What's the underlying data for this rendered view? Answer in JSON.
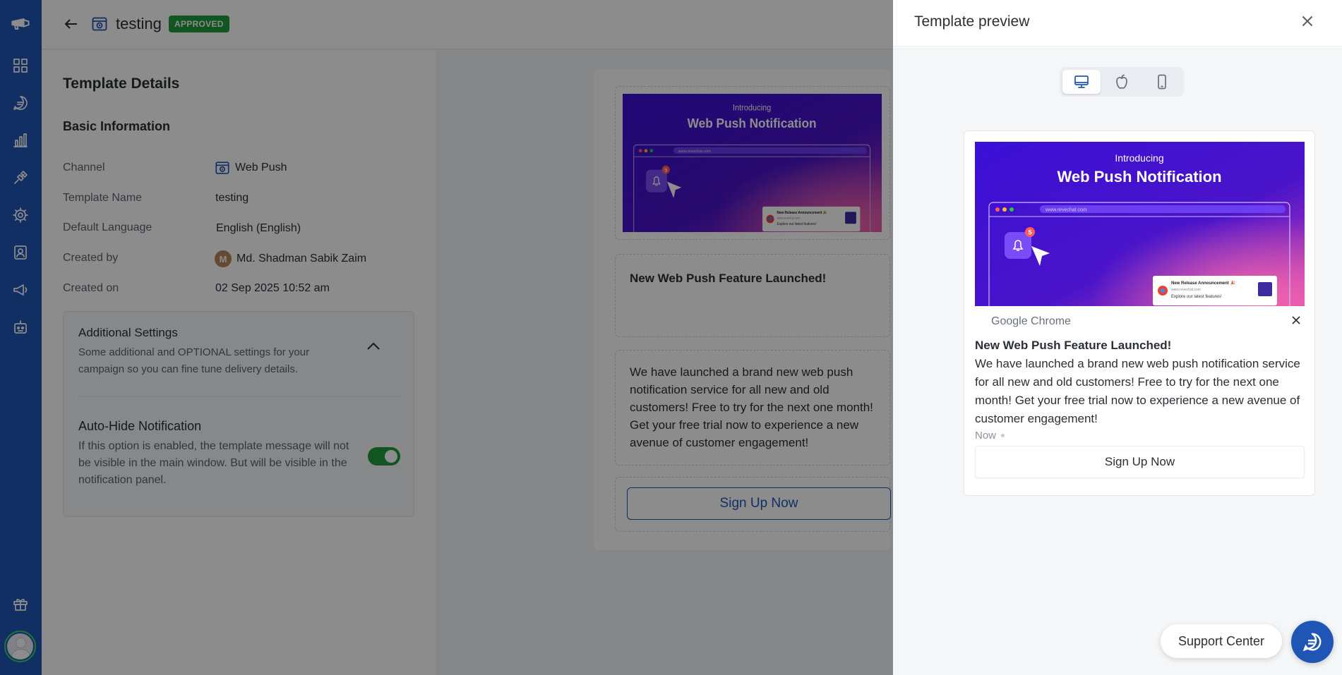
{
  "header": {
    "title": "testing",
    "status_badge": "APPROVED"
  },
  "template_details": {
    "heading": "Template Details",
    "section": "Basic Information",
    "fields": [
      {
        "label": "Channel",
        "value": "Web Push"
      },
      {
        "label": "Template Name",
        "value": "testing"
      },
      {
        "label": "Default Language",
        "value": "English (English)"
      },
      {
        "label": "Created by",
        "value": "Md. Shadman Sabik Zaim",
        "avatar_initial": "M"
      },
      {
        "label": "Created on",
        "value": "02 Sep 2025 10:52 am"
      }
    ],
    "additional_settings": {
      "title": "Additional Settings",
      "description": "Some additional and OPTIONAL settings for your campaign so you can fine tune delivery details.",
      "auto_hide": {
        "title": "Auto-Hide Notification",
        "description": "If this option is enabled, the template message will not be visible in the main window. But will be visible in the notification panel.",
        "enabled": true
      }
    }
  },
  "banner": {
    "kicker": "Introducing",
    "headline": "Web Push Notification",
    "url": "www.revechat.com",
    "badge_count": "5",
    "popup_title": "New Release Announcement 🎉",
    "popup_url": "www.revechat.com",
    "popup_text": "Explore our latest features!"
  },
  "message": {
    "title": "New Web Push Feature Launched!",
    "body": "We have launched a brand new web push notification service for all new and old customers! Free to try for the next one month! Get your free trial now to experience a new avenue of customer engagement!",
    "button": "Sign Up Now"
  },
  "drawer": {
    "title": "Template preview",
    "devices": [
      "desktop",
      "apple",
      "mobile"
    ],
    "active_device": "desktop",
    "notification": {
      "source": "Google Chrome",
      "time": "Now"
    }
  },
  "support": {
    "label": "Support Center"
  },
  "colors": {
    "sidebar": "#1f56b5",
    "approved": "#1f9b3b",
    "banner_start": "#3a0fd6",
    "banner_end": "#c93fb5"
  }
}
